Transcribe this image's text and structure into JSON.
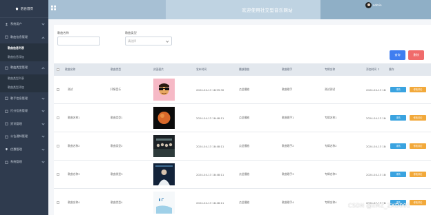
{
  "sidebar": {
    "brand": "后台首页",
    "items": [
      {
        "label": "系统用户",
        "icon": "user-icon",
        "has_children": true
      },
      {
        "label": "歌曲信息管理",
        "icon": "folder-icon",
        "has_children": true
      },
      {
        "label": "歌曲信息列表",
        "sub": true,
        "active": true
      },
      {
        "label": "歌曲信息添加",
        "sub": true
      },
      {
        "label": "歌曲类型管理",
        "icon": "folder-icon",
        "has_children": true
      },
      {
        "label": "歌曲类型列表",
        "sub": true
      },
      {
        "label": "歌曲类型添加",
        "sub": true
      },
      {
        "label": "歌手信息管理",
        "icon": "folder-icon",
        "has_children": true
      },
      {
        "label": "打分信息管理",
        "icon": "folder-icon",
        "has_children": true
      },
      {
        "label": "资讯管理",
        "icon": "folder-icon",
        "has_children": true
      },
      {
        "label": "公告通知管理",
        "icon": "folder-icon",
        "has_children": true
      },
      {
        "label": "优惠管理",
        "icon": "location-icon",
        "has_children": true
      },
      {
        "label": "系统管理",
        "icon": "folder-icon",
        "has_children": true
      }
    ]
  },
  "header": {
    "title": "欢迎使用社交型音乐网站",
    "username": "admin"
  },
  "search": {
    "name_label": "歌曲名称",
    "type_label": "歌曲类型",
    "type_placeholder": "请选择"
  },
  "toolbar": {
    "query_label": "查询",
    "delete_label": "删除"
  },
  "table": {
    "headers": [
      "歌曲名称",
      "歌曲类型",
      "封面图片",
      "发布时间",
      "播放歌曲",
      "歌曲歌手",
      "专辑名称",
      "添加时间 ↕",
      "操作"
    ],
    "rows": [
      {
        "name": "测试",
        "type": "抒情音乐",
        "publish": "2024-04-13 18:59:30",
        "play": "点此播放",
        "singer": "歌曲歌手",
        "album": "测试测试",
        "added": "2024-04-13 18:",
        "cover": "cover-cartoon"
      },
      {
        "name": "歌曲名称1",
        "type": "歌曲类型1",
        "publish": "2024-04-13 18:48:11",
        "play": "点此播放",
        "singer": "歌曲歌手1",
        "album": "专辑名称1",
        "added": "2024-04-13 18:",
        "cover": "cover-planet"
      },
      {
        "name": "歌曲名称2",
        "type": "歌曲类型2",
        "publish": "2024-04-13 18:48:11",
        "play": "点此播放",
        "singer": "歌曲歌手2",
        "album": "专辑名称2",
        "added": "2024-04-13 18:",
        "cover": "cover-band"
      },
      {
        "name": "歌曲名称3",
        "type": "歌曲类型3",
        "publish": "2024-04-13 18:48:11",
        "play": "点此播放",
        "singer": "歌曲歌手3",
        "album": "专辑名称3",
        "added": "2024-04-13 18:",
        "cover": "cover-person"
      },
      {
        "name": "歌曲名称4",
        "type": "歌曲类型4",
        "publish": "2024-04-13 18:48:11",
        "play": "点此播放",
        "singer": "歌曲歌手4",
        "album": "专辑名称4",
        "added": "2024-04-13 18:",
        "cover": "cover-logo"
      }
    ],
    "action_detail": "详情",
    "action_edit": "修改评论"
  },
  "watermark": "CSDN @xMZ_ZXD001",
  "colors": {
    "sidebar": "#2f3b4e",
    "header": "#a7c0d4",
    "query_btn": "#3f7ef0",
    "delete_btn": "#f06b6b",
    "detail_btn": "#3aa3e0",
    "edit_btn": "#f2a93b"
  }
}
